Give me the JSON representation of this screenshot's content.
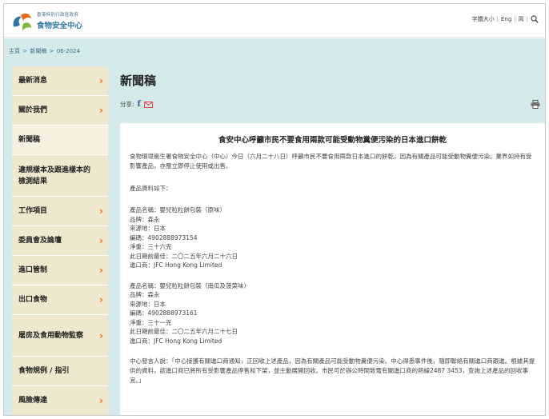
{
  "header": {
    "org_name": "香港特別行政區政府",
    "site_name": "食物安全中心",
    "font_size_label": "字體大小",
    "lang_label": "Eng",
    "lang_alt": "简",
    "search_icon": "search-icon"
  },
  "breadcrumb": [
    "主頁",
    ">",
    "新聞稿",
    ">",
    "06-2024"
  ],
  "sidebar": {
    "items": [
      {
        "label": "最新消息",
        "chevron": "›"
      },
      {
        "label": "關於我們",
        "chevron": "›"
      },
      {
        "label": "新聞稿",
        "chevron": ""
      },
      {
        "label": "違規樣本及跟進樣本的檢測結果",
        "chevron": ""
      },
      {
        "label": "工作項目",
        "chevron": "›"
      },
      {
        "label": "委員會及論壇",
        "chevron": "›"
      },
      {
        "label": "進口管制",
        "chevron": "›"
      },
      {
        "label": "出口食物",
        "chevron": "›"
      },
      {
        "label": "屠房及食用動物監察",
        "chevron": "›"
      },
      {
        "label": "食物規例 / 指引",
        "chevron": ""
      },
      {
        "label": "風險傳達",
        "chevron": "›"
      }
    ]
  },
  "main": {
    "title": "新聞稿",
    "share_label": "分享:",
    "facebook_icon": "f",
    "article": {
      "headline": "食安中心呼籲市民不要食用兩款可能受動物糞便污染的日本進口餅乾",
      "intro": "食物環境衞生署食物安全中心（中心）今日（六月二十八日）呼籲市民不要食用兩款日本進口的餅乾，因為有關產品可能受動物糞便污染。業界如持有受影響產品，亦應立即停止使用或出售。",
      "details_heading": "產品資料如下：",
      "products": [
        {
          "name": "產品名稱：嬰兒粒粒餅包裝（原味）",
          "brand": "品牌：森永",
          "origin": "來源地：日本",
          "code": "編碼：4902888973154",
          "weight": "淨重：三十六克",
          "best_before": "此日期前最佳：二〇二五年六月二十六日",
          "importer": "進口商：JFC Hong Kong Limited"
        },
        {
          "name": "產品名稱：嬰兒粒粒餅包裝（南瓜及菠菜味）",
          "brand": "品牌：森永",
          "origin": "來源地：日本",
          "code": "編碼：4902888973161",
          "weight": "淨重：三十一克",
          "best_before": "此日期前最佳：二〇二五年六月二十七日",
          "importer": "進口商：JFC Hong Kong Limited"
        }
      ],
      "spokesman": "中心發言人說：「中心接獲有關進口商通知，正回收上述產品，因為有關產品可能受動物糞便污染。中心得悉事件後，隨即聯絡有關進口商跟進。根據其提供的資料，該進口商已將所有受影響產品停售和下架，並主動展開回收。市民可於辦公時間致電有關進口商的熱線2487 3453，查詢上述產品的回收事宜。」"
    }
  },
  "colors": {
    "band": "#d4e9ea",
    "sidebar": "#f0e7cf",
    "chevron": "#e46a1c",
    "brand_blue": "#2f77a3"
  }
}
